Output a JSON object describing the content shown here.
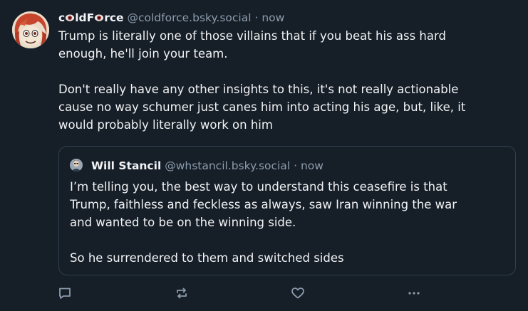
{
  "post": {
    "display_name_parts": [
      "c",
      "ldF",
      "rce"
    ],
    "handle": "@coldforce.bsky.social",
    "separator": "·",
    "time": "now",
    "text": "Trump is literally one of those villains that if you beat his ass hard\nenough, he'll join your team.\n\nDon't really have any other insights to this, it's not really actionable\ncause no way schumer just canes him into acting his age, but, like, it\nwould probably literally work on him"
  },
  "quote": {
    "display_name": "Will Stancil",
    "handle": "@whstancil.bsky.social",
    "separator": "·",
    "time": "now",
    "text": "I’m telling you, the best way to understand this ceasefire is that\nTrump, faithless and feckless as always, saw Iran winning the war\nand wanted to be on the winning side.\n\nSo he surrendered to them and switched sides"
  },
  "icons": {
    "reply": "speech-bubble-icon",
    "repost": "repost-arrows-icon",
    "like": "heart-icon",
    "more": "ellipsis-icon",
    "name_decoration": "eye-icon"
  },
  "colors": {
    "background": "#161e27",
    "text": "#f1f3f5",
    "muted": "#8c9cad",
    "border": "#2e4052",
    "eye_iris": "#a82b2b"
  }
}
